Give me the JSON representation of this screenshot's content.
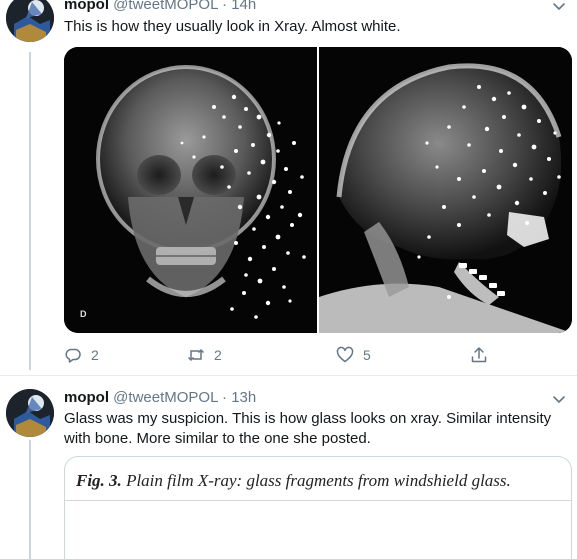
{
  "tweets": [
    {
      "name": "mopol",
      "handle": "@tweetMOPOL",
      "separator": "·",
      "time": "14h",
      "text": "This is how they usually look in Xray. Almost white.",
      "media": [
        {
          "icon": "skull-frontal-xray-image",
          "marker": "D"
        },
        {
          "icon": "skull-lateral-xray-image"
        }
      ],
      "actions": {
        "reply_count": "2",
        "retweet_count": "2",
        "like_count": "5"
      }
    },
    {
      "name": "mopol",
      "handle": "@tweetMOPOL",
      "separator": "·",
      "time": "13h",
      "text": "Glass was my suspicion. This is how glass looks on xray. Similar intensity with bone. More similar to the one she posted.",
      "card": {
        "label": "Fig. 3.",
        "title": "Plain film X-ray: glass fragments from windshield glass."
      }
    }
  ],
  "colors": {
    "text": "#14171a",
    "muted": "#657786",
    "thread_line": "#ccd6dd",
    "xray_background": "#050505"
  }
}
